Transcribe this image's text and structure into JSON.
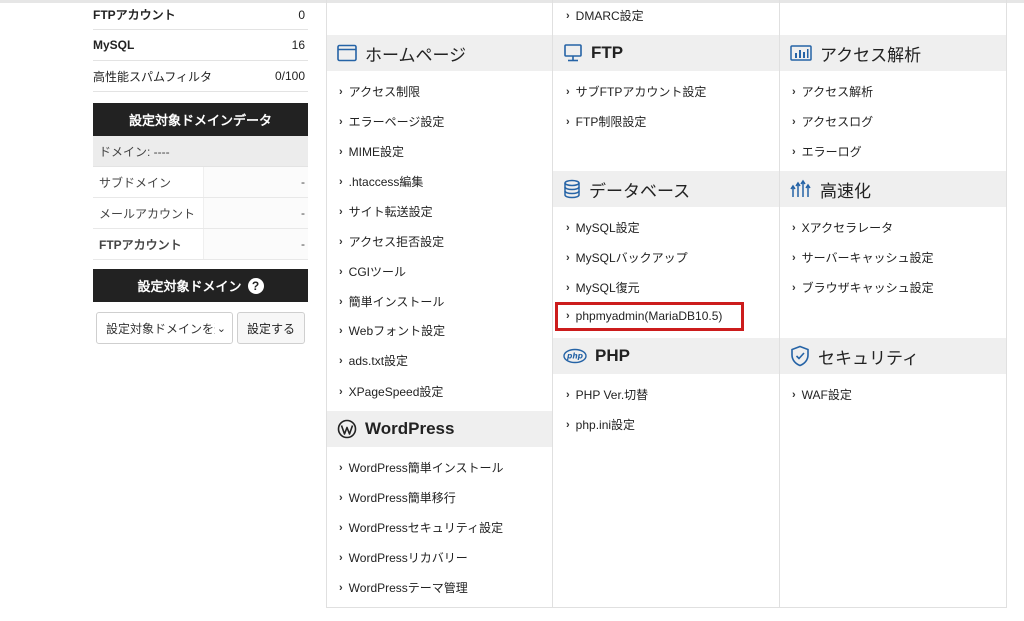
{
  "sidebar": {
    "stats": [
      {
        "label": "FTPアカウント",
        "value": "0"
      },
      {
        "label": "MySQL",
        "value": "16"
      },
      {
        "label": "高性能スパムフィルタ",
        "value": "0/100"
      }
    ],
    "domain_data_header": "設定対象ドメインデータ",
    "domain_line": "ドメイン: ----",
    "domain_details": [
      {
        "label": "サブドメイン",
        "value": "-"
      },
      {
        "label": "メールアカウント",
        "value": "-"
      },
      {
        "label": "FTPアカウント",
        "value": "-"
      }
    ],
    "domain_select_header": "設定対象ドメイン",
    "help_glyph": "?",
    "select_value": "設定対象ドメインを選",
    "set_button": "設定する"
  },
  "columns": {
    "col1": {
      "homepage": {
        "title": "ホームページ",
        "icon": "window-icon",
        "links": [
          "アクセス制限",
          "エラーページ設定",
          "MIME設定",
          ".htaccess編集",
          "サイト転送設定",
          "アクセス拒否設定",
          "CGIツール",
          "簡単インストール",
          "Webフォント設定",
          "ads.txt設定",
          "XPageSpeed設定"
        ]
      },
      "wordpress": {
        "title": "WordPress",
        "icon": "wordpress-icon",
        "links": [
          "WordPress簡単インストール",
          "WordPress簡単移行",
          "WordPressセキュリティ設定",
          "WordPressリカバリー",
          "WordPressテーマ管理"
        ]
      }
    },
    "col2": {
      "top_link": "DMARC設定",
      "ftp": {
        "title": "FTP",
        "icon": "monitor-icon",
        "links": [
          "サブFTPアカウント設定",
          "FTP制限設定"
        ]
      },
      "database": {
        "title": "データベース",
        "icon": "database-icon",
        "links": [
          "MySQL設定",
          "MySQLバックアップ",
          "MySQL復元",
          "phpmyadmin(MariaDB10.5)"
        ]
      },
      "php": {
        "title": "PHP",
        "icon": "php-icon",
        "icon_text": "php",
        "links": [
          "PHP Ver.切替",
          "php.ini設定"
        ]
      }
    },
    "col3": {
      "analytics": {
        "title": "アクセス解析",
        "icon": "bar-chart-icon",
        "links": [
          "アクセス解析",
          "アクセスログ",
          "エラーログ"
        ]
      },
      "speed": {
        "title": "高速化",
        "icon": "speed-arrows-icon",
        "links": [
          "Xアクセラレータ",
          "サーバーキャッシュ設定",
          "ブラウザキャッシュ設定"
        ]
      },
      "security": {
        "title": "セキュリティ",
        "icon": "shield-icon",
        "links": [
          "WAF設定"
        ]
      }
    }
  },
  "highlight_color": "#cc1c1c",
  "highlighted_item": "phpmyadmin(MariaDB10.5)",
  "link_arrow": "›"
}
